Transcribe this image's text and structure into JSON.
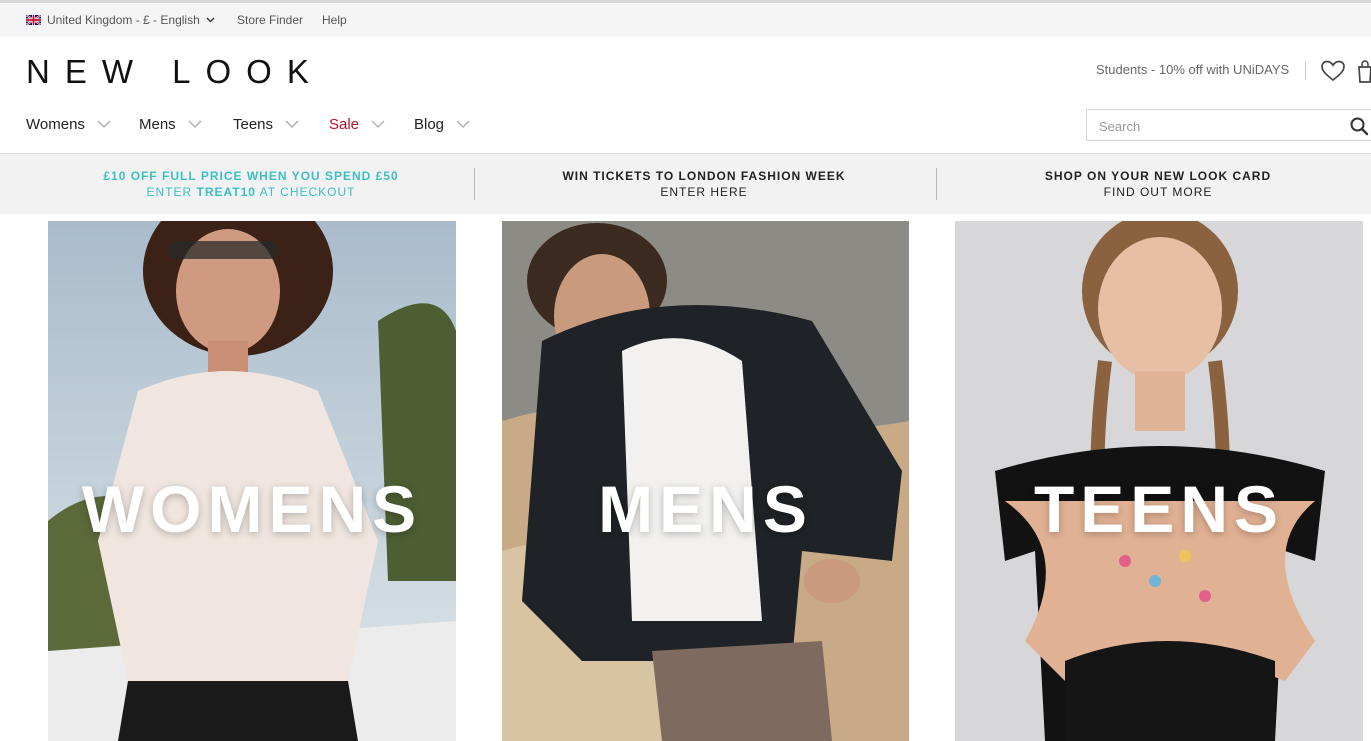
{
  "utility_bar": {
    "region_label": "United Kingdom - £ - English",
    "store_finder": "Store Finder",
    "help": "Help",
    "flag_icon": "uk-flag-icon"
  },
  "header": {
    "logo_text": "NEW LOOK",
    "students_promo": "Students - 10% off with UNiDAYS",
    "wishlist_icon": "heart-icon",
    "bag_icon": "shopping-bag-icon"
  },
  "nav": {
    "items": [
      {
        "label": "Womens"
      },
      {
        "label": "Mens"
      },
      {
        "label": "Teens"
      },
      {
        "label": "Sale",
        "color": "#b5102b"
      },
      {
        "label": "Blog"
      }
    ]
  },
  "search": {
    "placeholder": "Search",
    "value": ""
  },
  "promo_bar": {
    "items": [
      {
        "line1": "£10 OFF FULL PRICE WHEN YOU SPEND £50",
        "line2_prefix": "ENTER ",
        "line2_code": "TREAT10",
        "line2_suffix": " AT CHECKOUT",
        "color": "#3bbfc7"
      },
      {
        "line1": "WIN TICKETS TO LONDON FASHION WEEK",
        "line2": "ENTER HERE"
      },
      {
        "line1": "SHOP ON YOUR NEW LOOK CARD",
        "line2": "FIND OUT MORE"
      }
    ]
  },
  "tiles": [
    {
      "label": "WOMENS"
    },
    {
      "label": "MENS"
    },
    {
      "label": "TEENS"
    }
  ]
}
